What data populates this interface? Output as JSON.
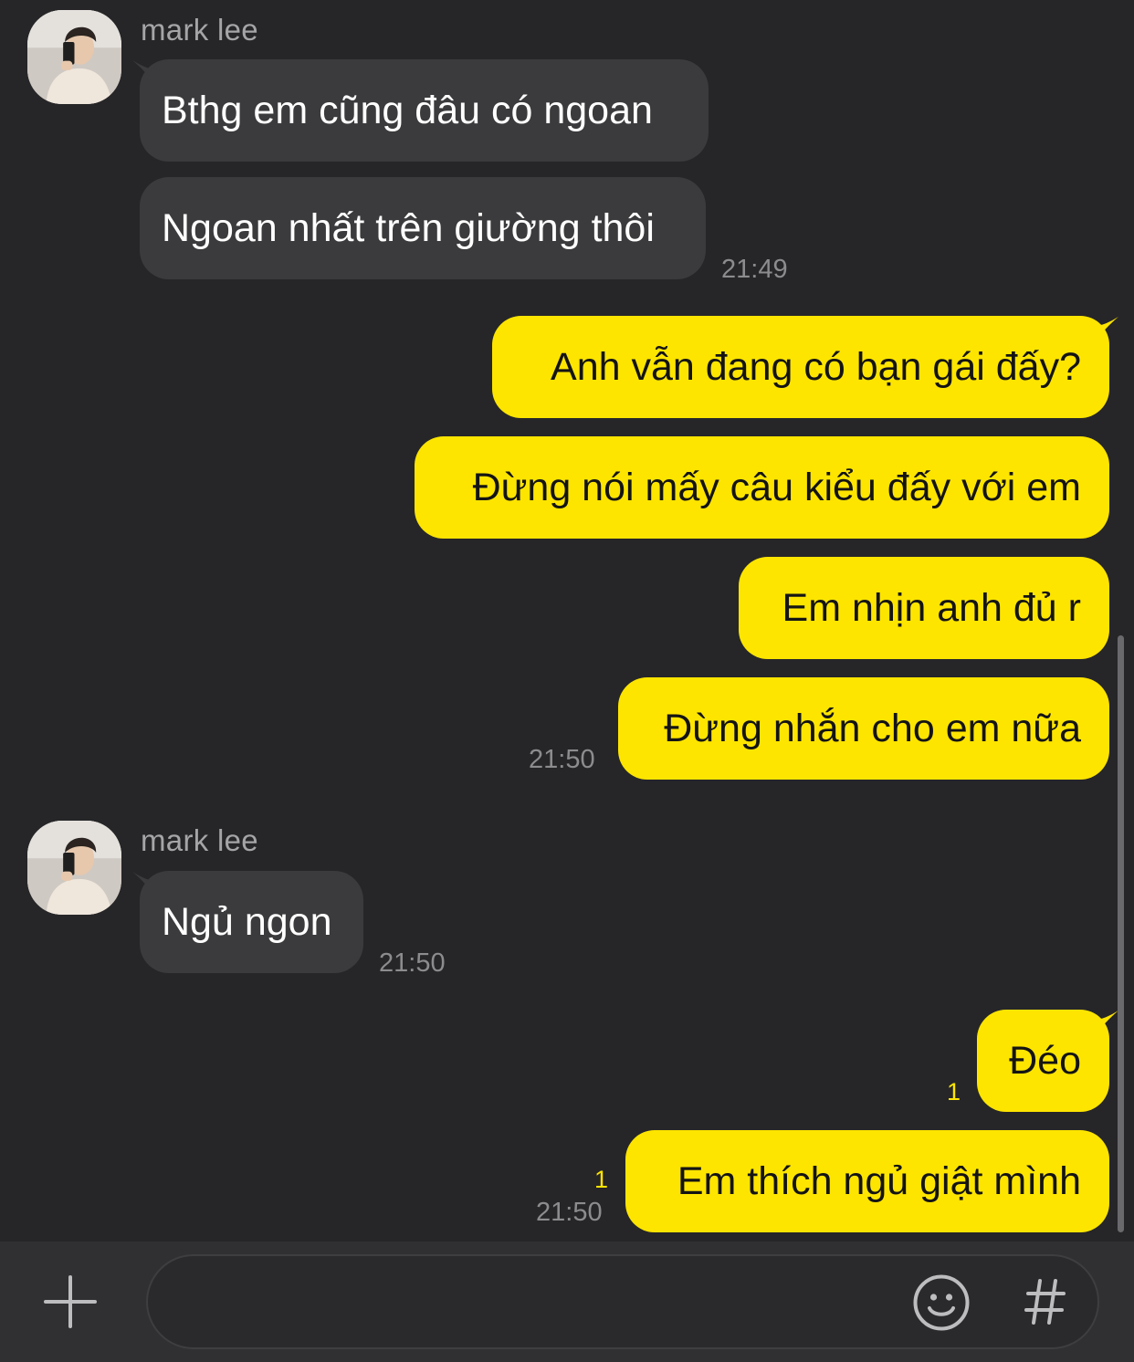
{
  "messages": [
    {
      "type": "incoming-group",
      "sender": "mark lee",
      "bubbles": [
        "Bthg em cũng đâu có ngoan",
        "Ngoan nhất trên giường thôi"
      ],
      "time": "21:49"
    },
    {
      "type": "outgoing-group",
      "bubbles": [
        "Anh vẫn đang có bạn gái đấy?",
        "Đừng nói mấy câu kiểu đấy với em",
        "Em nhịn anh đủ r",
        "Đừng nhắn cho em nữa"
      ],
      "time": "21:50"
    },
    {
      "type": "incoming-group",
      "sender": "mark lee",
      "bubbles": [
        "Ngủ ngon"
      ],
      "time": "21:50"
    },
    {
      "type": "outgoing-group",
      "bubbles": [
        {
          "text": "Đéo",
          "unread": "1"
        },
        {
          "text": "Em thích ngủ giật mình",
          "unread": "1"
        }
      ],
      "time": "21:50"
    }
  ],
  "composer": {
    "value": "",
    "icons": [
      "plus-icon",
      "emoji-icon",
      "hashtag-icon"
    ]
  },
  "colors": {
    "background": "#262628",
    "incoming_bubble": "#3b3b3d",
    "outgoing_bubble": "#fee500",
    "unread_count": "#fee500"
  }
}
